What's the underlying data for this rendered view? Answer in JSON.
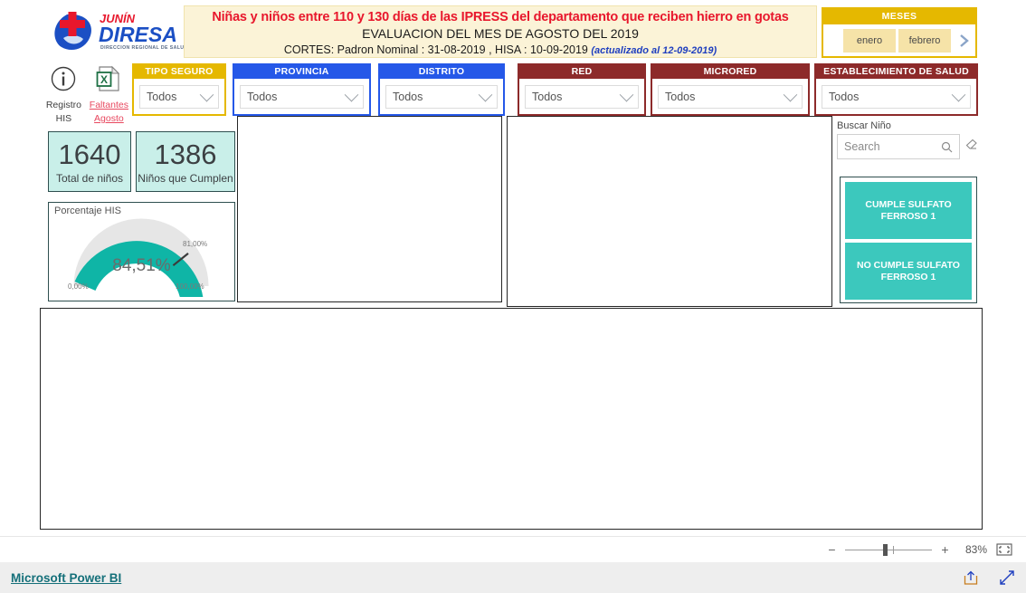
{
  "header": {
    "logo_brand": "JUNÍN",
    "logo_name": "DIRESA",
    "logo_sub": "DIRECCION REGIONAL DE SALUD",
    "title_line1": "Niñas y niños entre 110 y 130 días de las IPRESS del departamento que reciben hierro en gotas",
    "title_line2": "EVALUACION DEL MES DE AGOSTO DEL 2019",
    "title_line3": "CORTES: Padron Nominal : 31-08-2019 ,  HISA : 10-09-2019 ",
    "title_line3_note": "(actualizado al 12-09-2019)"
  },
  "meses": {
    "title": "MESES",
    "months": [
      "enero",
      "febrero"
    ],
    "next_label": "›"
  },
  "icons": {
    "registro_his": "Registro\nHIS",
    "registro_his_line1": "Registro",
    "registro_his_line2": "HIS",
    "faltantes_line1": "Faltantes",
    "faltantes_line2": " Agosto",
    "info_icon_name": "info-icon",
    "excel_icon_name": "excel-icon"
  },
  "slicers": [
    {
      "title": "TIPO SEGURO",
      "value": "Todos",
      "color": "#e5b800"
    },
    {
      "title": "PROVINCIA",
      "value": "Todos",
      "color": "#2558e8"
    },
    {
      "title": "DISTRITO",
      "value": "Todos",
      "color": "#2558e8"
    },
    {
      "title": "RED",
      "value": "Todos",
      "color": "#8d2a2a"
    },
    {
      "title": "MICRORED",
      "value": "Todos",
      "color": "#8d2a2a"
    },
    {
      "title": "ESTABLECIMIENTO DE SALUD",
      "value": "Todos",
      "color": "#8d2a2a"
    }
  ],
  "kpis": [
    {
      "value": "1640",
      "label": "Total de niños"
    },
    {
      "value": "1386",
      "label": "Niños que Cumplen"
    }
  ],
  "chart_data": {
    "type": "gauge",
    "title": "Porcentaje HIS",
    "value": 84.51,
    "value_label": "84,51%",
    "target": 81.0,
    "target_label": "81,00%",
    "min": 0,
    "max": 100,
    "min_label": "0,00%",
    "max_label": "100,00%",
    "fill_color": "#0fb5a6",
    "track_color": "#e6e6e6"
  },
  "search": {
    "label": "Buscar Niño",
    "placeholder": "Search",
    "value": ""
  },
  "filter_buttons": [
    {
      "label": "CUMPLE SULFATO FERROSO 1"
    },
    {
      "label": "NO CUMPLE SULFATO FERROSO 1"
    }
  ],
  "statusbar": {
    "zoom_out": "−",
    "zoom_in": "+",
    "zoom_level": "83%"
  },
  "footer": {
    "brand": "Microsoft Power BI"
  }
}
